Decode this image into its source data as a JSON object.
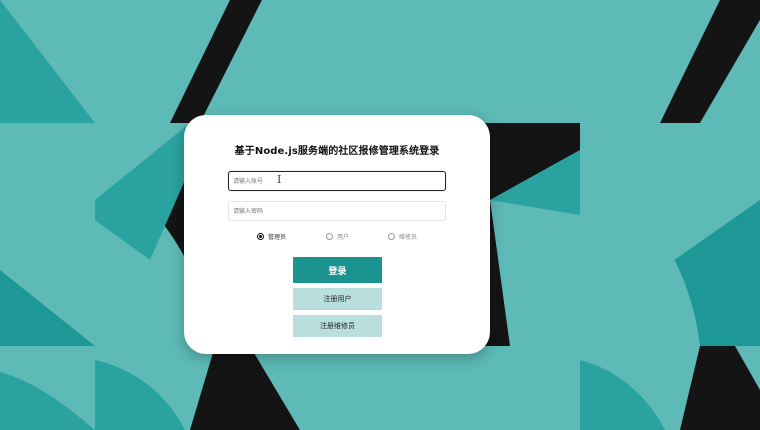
{
  "login_form": {
    "title": "基于Node.js服务端的社区报修管理系统登录",
    "username_placeholder": "请输入账号",
    "password_placeholder": "请输入密码",
    "roles": [
      {
        "label": "管理员",
        "checked": true
      },
      {
        "label": "用户",
        "checked": false
      },
      {
        "label": "维修员",
        "checked": false
      }
    ],
    "login_label": "登录",
    "register_user_label": "注册用户",
    "register_repair_label": "注册维修员"
  },
  "colors": {
    "background_teal": "#5dbab7",
    "dark_stripe": "#141414",
    "primary_button": "#1b9391",
    "secondary_button": "#b9dede"
  }
}
